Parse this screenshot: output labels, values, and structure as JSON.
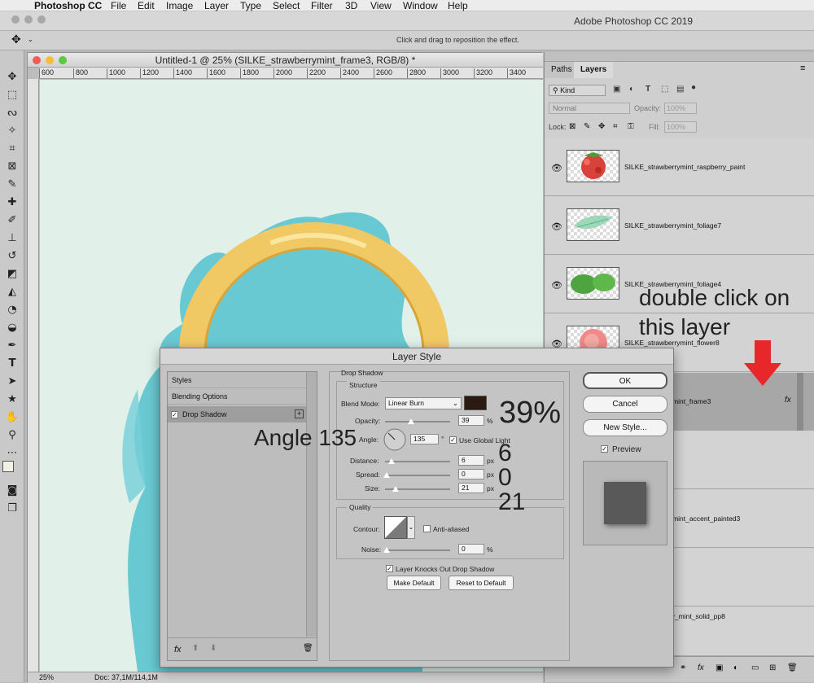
{
  "menubar": {
    "apple": "",
    "app": "Photoshop CC",
    "items": [
      "File",
      "Edit",
      "Image",
      "Layer",
      "Type",
      "Select",
      "Filter",
      "3D",
      "View",
      "Window",
      "Help"
    ]
  },
  "app_title": "Adobe Photoshop CC 2019",
  "options_hint": "Click and drag to reposition the effect.",
  "document": {
    "title": "Untitled-1 @ 25% (SILKE_strawberrymint_frame3, RGB/8) *",
    "ruler_ticks": [
      "600",
      "800",
      "1000",
      "1200",
      "1400",
      "1600",
      "1800",
      "2000",
      "2200",
      "2400",
      "2600",
      "2800",
      "3000",
      "3200",
      "3400"
    ],
    "zoom": "25%",
    "doc_info": "Doc: 37,1M/114,1M"
  },
  "panel": {
    "tabs": [
      "Paths",
      "Layers"
    ],
    "kind_label": "Kind",
    "blend": "Normal",
    "opacity_label": "Opacity:",
    "opacity_value": "100%",
    "lock_label": "Lock:",
    "fill_label": "Fill:",
    "fill_value": "100%",
    "layers": [
      {
        "name": "SILKE_strawberrymint_raspberry_paint"
      },
      {
        "name": "SILKE_strawberrymint_foliage7"
      },
      {
        "name": "SILKE_strawberrymint_foliage4"
      },
      {
        "name": "SILKE_strawberrymint_flower8"
      },
      {
        "name": "rymint_frame3"
      },
      {
        "name": ""
      },
      {
        "name": "rymint_accent_painted3"
      },
      {
        "name": ""
      },
      {
        "name": "rry_mint_solid_pp8"
      }
    ],
    "fx_label": "fx"
  },
  "annotations": {
    "double_click_line1": "double click on",
    "double_click_line2": "this layer",
    "angle": "Angle 135",
    "opacity": "39%",
    "distance": "6",
    "spread": "0",
    "size": "21"
  },
  "dialog": {
    "title": "Layer Style",
    "styles_label": "Styles",
    "blending_label": "Blending Options",
    "drop_shadow_label": "Drop Shadow",
    "section_title": "Drop Shadow",
    "structure_title": "Structure",
    "blend_mode_label": "Blend Mode:",
    "blend_mode_value": "Linear Burn",
    "shadow_color": "#2a1a10",
    "opacity_label": "Opacity:",
    "opacity_value": "39",
    "angle_label": "Angle:",
    "angle_value": "135",
    "global_light_label": "Use Global Light",
    "distance_label": "Distance:",
    "distance_value": "6",
    "spread_label": "Spread:",
    "spread_value": "0",
    "size_label": "Size:",
    "size_value": "21",
    "quality_title": "Quality",
    "contour_label": "Contour:",
    "anti_aliased_label": "Anti-aliased",
    "noise_label": "Noise:",
    "noise_value": "0",
    "knockout_label": "Layer Knocks Out Drop Shadow",
    "make_default": "Make Default",
    "reset_default": "Reset to Default",
    "ok": "OK",
    "cancel": "Cancel",
    "new_style": "New Style...",
    "preview_label": "Preview",
    "unit_percent": "%",
    "unit_px": "px",
    "unit_degree": "°",
    "fx_label": "fx"
  },
  "colors": {
    "canvas_bg": "#e1f1ea",
    "annotation_arrow": "#e8272b",
    "frame_gold": "#f1c964",
    "paint_blue": "#5cc4cf"
  }
}
